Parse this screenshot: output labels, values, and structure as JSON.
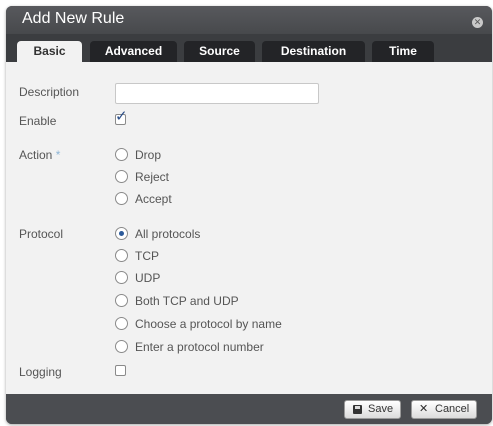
{
  "dialog": {
    "title": "Add New Rule",
    "close_icon": "close-icon"
  },
  "tabs": [
    {
      "label": "Basic",
      "active": true
    },
    {
      "label": "Advanced",
      "active": false
    },
    {
      "label": "Source",
      "active": false
    },
    {
      "label": "Destination",
      "active": false
    },
    {
      "label": "Time",
      "active": false
    }
  ],
  "form": {
    "description_label": "Description",
    "description_value": "",
    "enable_label": "Enable",
    "enable_checked": true,
    "action_label": "Action",
    "action_required_marker": "*",
    "action_options": [
      "Drop",
      "Reject",
      "Accept"
    ],
    "action_selected": null,
    "protocol_label": "Protocol",
    "protocol_options": [
      "All protocols",
      "TCP",
      "UDP",
      "Both TCP and UDP",
      "Choose a protocol by name",
      "Enter a protocol number"
    ],
    "protocol_selected": "All protocols",
    "logging_label": "Logging",
    "logging_checked": false
  },
  "footer": {
    "save_label": "Save",
    "cancel_label": "Cancel",
    "save_icon": "save-icon",
    "cancel_icon": "cancel-x-icon"
  },
  "colors": {
    "titlebar": "#4b4d51",
    "panel": "#f2f2f2",
    "tab_inactive": "#232427",
    "radio_selected": "#2c5a9a"
  }
}
